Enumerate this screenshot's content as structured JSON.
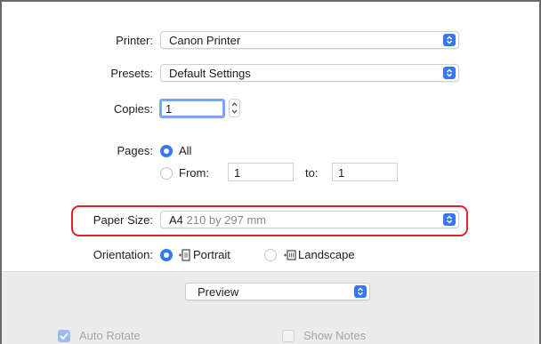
{
  "dialog": {
    "printer": {
      "label": "Printer:",
      "value": "Canon Printer"
    },
    "presets": {
      "label": "Presets:",
      "value": "Default Settings"
    },
    "copies": {
      "label": "Copies:",
      "value": "1"
    },
    "pages": {
      "label": "Pages:",
      "all_label": "All",
      "from_label": "From:",
      "from_value": "1",
      "to_label": "to:",
      "to_value": "1",
      "selected": "All"
    },
    "paper_size": {
      "label": "Paper Size:",
      "value": "A4",
      "detail": "210 by 297 mm"
    },
    "orientation": {
      "label": "Orientation:",
      "portrait_label": "Portrait",
      "landscape_label": "Landscape",
      "selected": "Portrait"
    },
    "section_popup": {
      "value": "Preview"
    },
    "options": {
      "auto_rotate_label": "Auto Rotate",
      "auto_rotate_checked": true,
      "show_notes_label": "Show Notes",
      "show_notes_checked": false
    }
  },
  "colors": {
    "accent": "#3478f6",
    "highlight": "#e0202e"
  },
  "icons": [
    "chevron-updown-icon",
    "stepper-icon",
    "portrait-orientation-icon",
    "landscape-orientation-icon"
  ]
}
